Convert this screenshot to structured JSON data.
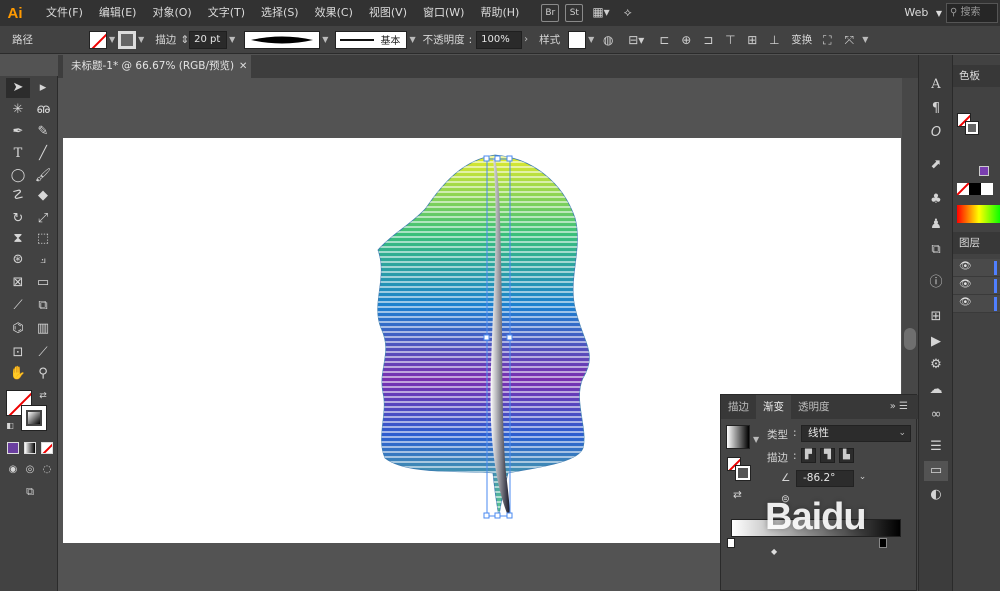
{
  "app": {
    "logo": "Ai"
  },
  "menu": [
    {
      "id": "file",
      "label": "文件(F)"
    },
    {
      "id": "edit",
      "label": "编辑(E)"
    },
    {
      "id": "object",
      "label": "对象(O)"
    },
    {
      "id": "type",
      "label": "文字(T)"
    },
    {
      "id": "select",
      "label": "选择(S)"
    },
    {
      "id": "effect",
      "label": "效果(C)"
    },
    {
      "id": "view",
      "label": "视图(V)"
    },
    {
      "id": "window",
      "label": "窗口(W)"
    },
    {
      "id": "help",
      "label": "帮助(H)"
    }
  ],
  "menubar_extras": {
    "bridge": "Br",
    "stock": "St"
  },
  "workspace": {
    "label": "Web",
    "search_placeholder": "搜索"
  },
  "control": {
    "object_type": "路径",
    "stroke_label": "描边",
    "stroke_value": "20 pt",
    "profile_label": "基本",
    "opacity_label": "不透明度",
    "opacity_value": "100%",
    "style_label": "样式",
    "transform_label": "变换"
  },
  "document": {
    "tab_title": "未标题-1* @ 66.67% (RGB/预览)",
    "close": "✕"
  },
  "panels": {
    "color_tab": "色板",
    "layers_tab": "图层"
  },
  "gradient_panel": {
    "tabs": [
      "描边",
      "渐变",
      "透明度"
    ],
    "active_tab": "渐变",
    "type_label": "类型",
    "type_value": "线性",
    "stroke_label": "描边",
    "angle_value": "-86.2°",
    "menu": "»"
  },
  "watermark": "Baidu"
}
